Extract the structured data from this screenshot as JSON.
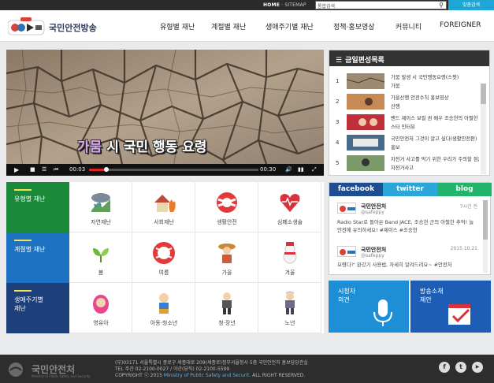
{
  "topbar": {
    "home": "HOME",
    "sep": " · ",
    "sitemap": "SITEMAP",
    "search_select": "통합검색",
    "detail_search": "맞춤검색"
  },
  "header": {
    "site_name": "국민안전방송"
  },
  "nav": [
    "유형별 재난",
    "계절별 재난",
    "생애주기별 재난",
    "정책·홍보영상",
    "커뮤니티",
    "FOREIGNER"
  ],
  "video": {
    "caption_highlight": "가뭄",
    "caption_rest": "시 국민 행동 요령",
    "time_current": "00:03",
    "time_total": "00:30",
    "progress_fraction": 0.1
  },
  "schedule": {
    "title": "금일편성목록",
    "items": [
      {
        "num": "1",
        "title": "가뭄 발생 시 국민행동요령(스팟)",
        "sub": "가뭄"
      },
      {
        "num": "2",
        "title": "가을산행 안전수칙 홍보영상",
        "sub": "산행"
      },
      {
        "num": "3",
        "title": "밴드 제이스 보컬 권 배우 조승현의 아찔한 추억",
        "sub": "스타 인터뷰"
      },
      {
        "num": "4",
        "title": "국민안전처 그것이 알고 싶다(생활안전편)",
        "sub": "홍보"
      },
      {
        "num": "5",
        "title": "자전거 사고를 막기 위한 우리가 주의할 점은?",
        "sub": "자전거사고"
      }
    ]
  },
  "categories": {
    "rows": [
      {
        "label": "유형별 재난",
        "color": "#1a8a3a",
        "items": [
          {
            "label": "자연재난",
            "icon": "natural-disaster-icon"
          },
          {
            "label": "사회재난",
            "icon": "social-disaster-icon"
          },
          {
            "label": "생활안전",
            "icon": "life-safety-icon"
          },
          {
            "label": "심폐소생술",
            "icon": "cpr-icon"
          }
        ]
      },
      {
        "label": "계절별 재난",
        "color": "#1d72c2",
        "items": [
          {
            "label": "봄",
            "icon": "spring-icon"
          },
          {
            "label": "여름",
            "icon": "summer-icon"
          },
          {
            "label": "가을",
            "icon": "autumn-icon"
          },
          {
            "label": "겨울",
            "icon": "winter-icon"
          }
        ]
      },
      {
        "label_line1": "생애주기별",
        "label_line2": "재난",
        "color": "#1d3f7a",
        "items": [
          {
            "label": "영유아",
            "icon": "infant-icon"
          },
          {
            "label": "아동·청소년",
            "icon": "youth-icon"
          },
          {
            "label": "청·장년",
            "icon": "adult-icon"
          },
          {
            "label": "노년",
            "icon": "senior-icon"
          }
        ]
      }
    ]
  },
  "social": {
    "tabs": [
      {
        "label": "facebook",
        "color": "#1f4d8f"
      },
      {
        "label": "twitter",
        "color": "#2aa7d8"
      },
      {
        "label": "blog",
        "color": "#23b36a"
      }
    ],
    "posts": [
      {
        "name": "국민안전처",
        "id": "@safeppy",
        "date": "7시간 전",
        "text": "Radio Star로 돌아온 Band JACE, 조승현 군의 아찔한 추억! 늘 안전에 유의하세요! #제이스 #조승현"
      },
      {
        "name": "국민안전처",
        "id": "@safeppy",
        "date": "2015.10.21",
        "text": "요령다?' 완강기 사용법, 자세히 알려드려요~ #안전처"
      }
    ]
  },
  "boxes": [
    {
      "line1": "시청자",
      "line2": "의견",
      "color": "#1e8fd6",
      "icon": "microphone-icon"
    },
    {
      "line1": "방송소재",
      "line2": "제안",
      "color": "#1e5db5",
      "icon": "checklist-icon"
    }
  ],
  "footer": {
    "logo": "국민안전처",
    "logo_sub": "Ministry of Public Safety and Security",
    "address": "(우)03171 서울특별시 종로구 세종대로 209(세종로)정부서울청사 5층 국민안전처 홍보담당관실",
    "tel": "TEL 주간 02-2100-0027 / 야간(당직) 02-2100-5599",
    "copy_prefix": "COPYRIGHT ⓒ 2015",
    "copy_ministry": "Ministry of Public Safety and Securit.",
    "copy_suffix": "ALL RIGHT RESERVED.",
    "sns": [
      "f",
      "t",
      "▶"
    ]
  }
}
